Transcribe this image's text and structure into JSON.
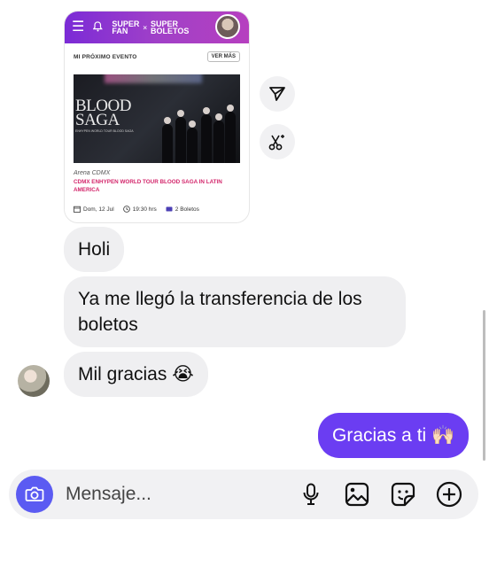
{
  "card": {
    "menu_icon": "hamburger-icon",
    "bell_icon": "bell-icon",
    "logo_left_1": "SUPER",
    "logo_left_2": "FAN",
    "logo_sep": "×",
    "logo_right_1": "SUPER",
    "logo_right_2": "BOLETOS",
    "section_title": "MI PRÓXIMO EVENTO",
    "see_more": "VER MÁS",
    "poster_title_1": "BLOOD",
    "poster_title_2": "SAGA",
    "poster_tour": "ENHYPEN WORLD TOUR BLOOD SAGA",
    "venue": "Arena CDMX",
    "event_title": "CDMX ENHYPEN WORLD TOUR BLOOD SAGA IN LATIN AMERICA",
    "date": "Dom, 12 Jul",
    "time": "19:30 hrs",
    "tickets": "2 Boletos"
  },
  "side_actions": {
    "share_icon": "send-icon",
    "remix_icon": "sparkle-scissors-icon"
  },
  "messages": [
    {
      "from": "them",
      "text": "Holi"
    },
    {
      "from": "them",
      "text": "Ya me llegó la transferencia de los boletos"
    },
    {
      "from": "them",
      "text": "Mil gracias 😭"
    },
    {
      "from": "me",
      "text": "Gracias a ti 🙌🏻"
    }
  ],
  "composer": {
    "placeholder": "Mensaje...",
    "camera_icon": "camera-icon",
    "mic_icon": "microphone-icon",
    "gallery_icon": "image-icon",
    "sticker_icon": "sticker-icon",
    "plus_icon": "plus-circle-icon"
  },
  "colors": {
    "accent": "#6b3df2",
    "camera": "#5b5bf2",
    "bubble_them": "#efeff1",
    "event_title": "#d3266b"
  }
}
